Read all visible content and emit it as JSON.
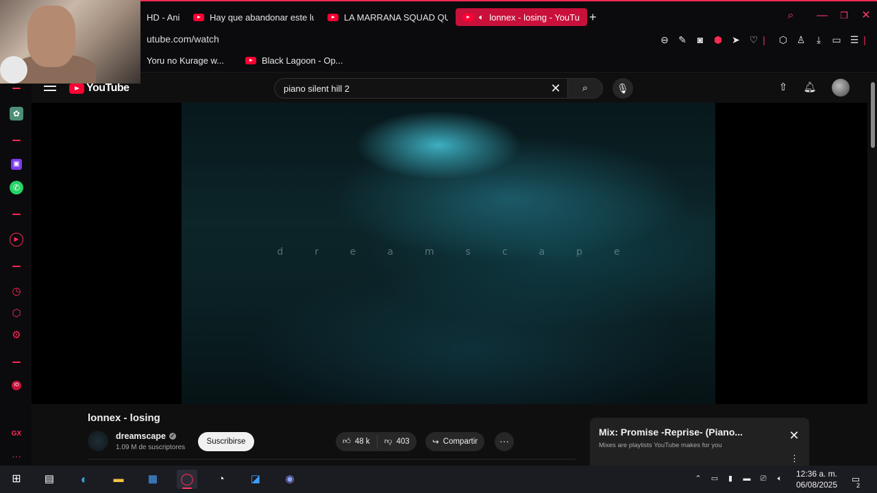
{
  "browser": {
    "tabs": [
      {
        "label": "HD - Ani"
      },
      {
        "label": "Hay que abandonar este lu"
      },
      {
        "label": "LA MARRANA SQUAD QUI"
      },
      {
        "label": "lonnex - losing - YouTu"
      }
    ],
    "new_tab_icon": "plus-icon",
    "url": "utube.com/watch",
    "bookmarks": [
      {
        "label": "Yoru no Kurage w..."
      },
      {
        "label": "Black Lagoon - Op..."
      }
    ],
    "accent_color": "#ff2a55"
  },
  "webcam": {
    "description_icon": "webcam-icon"
  },
  "youtube": {
    "logo_text": "YouTube",
    "search_value": "piano silent hill 2",
    "video": {
      "overlay_text": "dreamscape",
      "title": "lonnex - losing"
    },
    "channel": {
      "name": "dreamscape",
      "subscribers": "1.09 M de suscriptores",
      "subscribe_label": "Suscribirse"
    },
    "actions": {
      "likes": "48 k",
      "dislikes": "403",
      "share_label": "Compartir",
      "more_label": "···"
    },
    "mix": {
      "title": "Mix: Promise -Reprise- (Piano...",
      "subtitle": "Mixes are playlists YouTube makes for you"
    }
  },
  "taskbar": {
    "time": "12:36 a. m.",
    "date": "06/08/2025",
    "notification_count": "2"
  }
}
